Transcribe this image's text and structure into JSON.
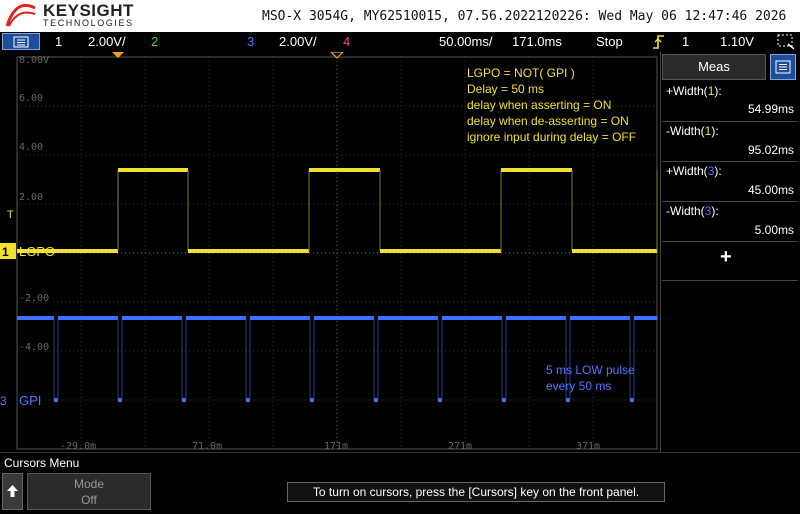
{
  "header": {
    "logo_word": "KEYSIGHT",
    "logo_sub": "TECHNOLOGIES",
    "title": "MSO-X 3054G, MY62510015, 07.56.2022120226: Wed May 06 12:47:46 2026"
  },
  "channel_bar": {
    "ch1_num": "1",
    "ch1_scale": "2.00V/",
    "ch2_num": "2",
    "ch3_num": "3",
    "ch3_scale": "2.00V/",
    "ch4_num": "4",
    "timebase": "50.00ms/",
    "delay": "171.0ms",
    "run_state": "Stop",
    "trigger_src": "1",
    "trigger_level": "1.10V"
  },
  "annotations": {
    "logic_lines": [
      "LGPO = NOT( GPI )",
      "Delay = 50 ms",
      "delay when asserting = ON",
      "delay when de-asserting = ON",
      "ignore input during delay = OFF"
    ],
    "pulse_lines": [
      "5 ms LOW pulse",
      "every 50 ms"
    ]
  },
  "waveforms": {
    "lgpo_label": "LGPO",
    "gpi_label": "GPI",
    "ch1_marker": "1",
    "ch3_marker": "3",
    "trigger_marker": "T",
    "y_ticks": [
      "8.00V",
      "6.00",
      "4.00",
      "2.00",
      "-2.00",
      "-4.00"
    ],
    "x_ticks": [
      "-29.0m",
      "71.0m",
      "171m",
      "271m",
      "371m"
    ]
  },
  "measurements": {
    "title": "Meas",
    "items": [
      {
        "label": "+Width(",
        "ch": "1",
        "suffix": "):",
        "value": "54.99ms"
      },
      {
        "label": "-Width(",
        "ch": "1",
        "suffix": "):",
        "value": "95.02ms"
      },
      {
        "label": "+Width(",
        "ch": "3",
        "suffix": "):",
        "value": "45.00ms"
      },
      {
        "label": "-Width(",
        "ch": "3",
        "suffix": "):",
        "value": "5.00ms"
      }
    ],
    "add": "+"
  },
  "bottom": {
    "menu_title": "Cursors Menu",
    "mode_label": "Mode",
    "mode_value": "Off",
    "hint": "To turn on cursors, press the [Cursors] key on the front panel."
  },
  "colors": {
    "ch1": "#f0e030",
    "ch3": "#3f6fff"
  }
}
